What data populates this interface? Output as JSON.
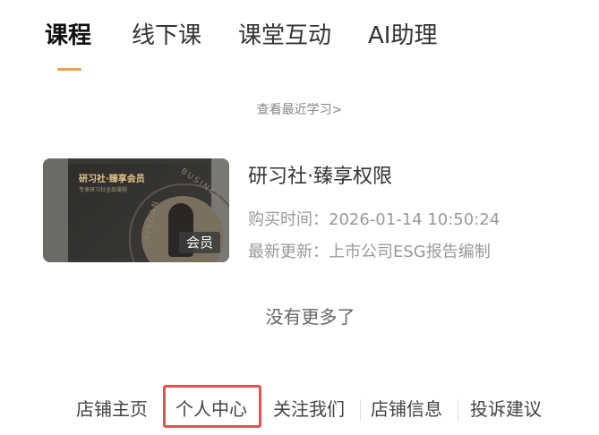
{
  "tabs": [
    {
      "label": "课程",
      "active": true
    },
    {
      "label": "线下课",
      "active": false
    },
    {
      "label": "课堂互动",
      "active": false
    },
    {
      "label": "AI助理",
      "active": false
    }
  ],
  "accent_color": "#f0a050",
  "recent_link": "查看最近学习>",
  "course": {
    "thumb_title": "研习社·臻享会员",
    "thumb_subtitle": "专享研习社全部课程",
    "thumb_ring_text": "BUSINES",
    "thumb_ring_text_left": "XIAOAN",
    "badge": "会员",
    "title": "研习社·臻享权限",
    "purchase_time": "购买时间：2026-01-14 10:50:24",
    "latest_update": "最新更新：上市公司ESG报告编制"
  },
  "no_more": "没有更多了",
  "footer": {
    "items": [
      "店铺主页",
      "个人中心",
      "关注我们",
      "店铺信息",
      "投诉建议"
    ],
    "highlight_color": "#e2524d"
  }
}
